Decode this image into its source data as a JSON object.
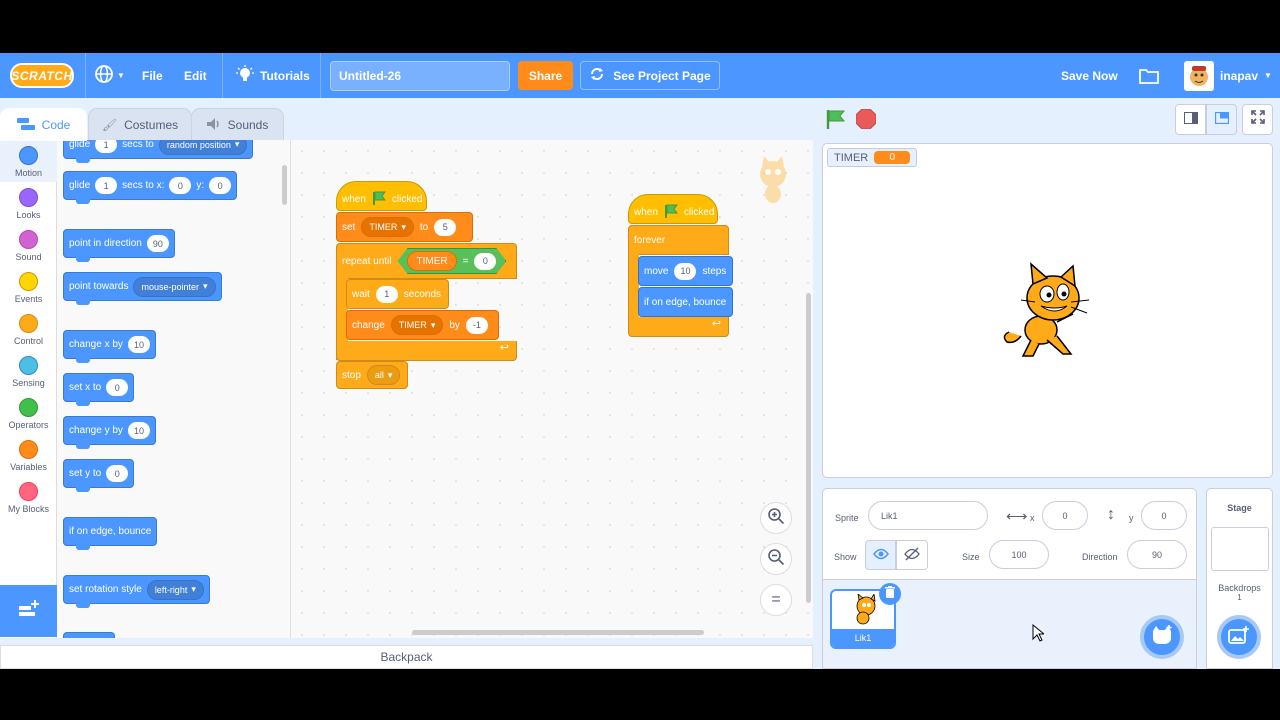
{
  "menubar": {
    "logo": "SCRATCH",
    "file": "File",
    "edit": "Edit",
    "tutorials": "Tutorials",
    "project_title": "Untitled-26",
    "share": "Share",
    "see_project_page": "See Project Page",
    "save_now": "Save Now",
    "username": "inapav"
  },
  "tabs": {
    "code": "Code",
    "costumes": "Costumes",
    "sounds": "Sounds"
  },
  "categories": [
    {
      "label": "Motion",
      "color": "#4c97ff"
    },
    {
      "label": "Looks",
      "color": "#9966ff"
    },
    {
      "label": "Sound",
      "color": "#cf63cf"
    },
    {
      "label": "Events",
      "color": "#ffd500"
    },
    {
      "label": "Control",
      "color": "#ffab19"
    },
    {
      "label": "Sensing",
      "color": "#4cbfe6"
    },
    {
      "label": "Operators",
      "color": "#40bf4a"
    },
    {
      "label": "Variables",
      "color": "#ff8c1a"
    },
    {
      "label": "My Blocks",
      "color": "#ff6680"
    }
  ],
  "palette": {
    "glide_random": {
      "a": "glide",
      "n": "1",
      "b": "secs to",
      "drop": "random position"
    },
    "glide_xy": {
      "a": "glide",
      "n": "1",
      "b": "secs to x:",
      "x": "0",
      "c": "y:",
      "y": "0"
    },
    "point_dir": {
      "a": "point in direction",
      "n": "90"
    },
    "point_towards": {
      "a": "point towards",
      "drop": "mouse-pointer"
    },
    "change_x": {
      "a": "change x by",
      "n": "10"
    },
    "set_x": {
      "a": "set x to",
      "n": "0"
    },
    "change_y": {
      "a": "change y by",
      "n": "10"
    },
    "set_y": {
      "a": "set y to",
      "n": "0"
    },
    "bounce": "if on edge, bounce",
    "rotation": {
      "a": "set rotation style",
      "drop": "left-right"
    }
  },
  "script1": {
    "hat": {
      "a": "when",
      "b": "clicked"
    },
    "set": {
      "a": "set",
      "var": "TIMER",
      "b": "to",
      "val": "5"
    },
    "repeat_until": {
      "a": "repeat until",
      "var": "TIMER",
      "op": "=",
      "val": "0"
    },
    "wait": {
      "a": "wait",
      "val": "1",
      "b": "seconds"
    },
    "change": {
      "a": "change",
      "var": "TIMER",
      "b": "by",
      "val": "-1"
    },
    "stop": {
      "a": "stop",
      "drop": "all"
    }
  },
  "script2": {
    "hat": {
      "a": "when",
      "b": "clicked"
    },
    "forever": "forever",
    "move": {
      "a": "move",
      "val": "10",
      "b": "steps"
    },
    "bounce": "if on edge, bounce"
  },
  "backpack": "Backpack",
  "stage": {
    "monitor_label": "TIMER",
    "monitor_value": "0"
  },
  "sprite_info": {
    "sprite_label": "Sprite",
    "sprite_name": "Lik1",
    "x_label": "x",
    "x": "0",
    "y_label": "y",
    "y": "0",
    "show_label": "Show",
    "size_label": "Size",
    "size": "100",
    "direction_label": "Direction",
    "direction": "90"
  },
  "sprites": [
    {
      "name": "Lik1"
    }
  ],
  "stage_panel": {
    "title": "Stage",
    "backdrops_label": "Backdrops",
    "backdrops_count": "1"
  }
}
